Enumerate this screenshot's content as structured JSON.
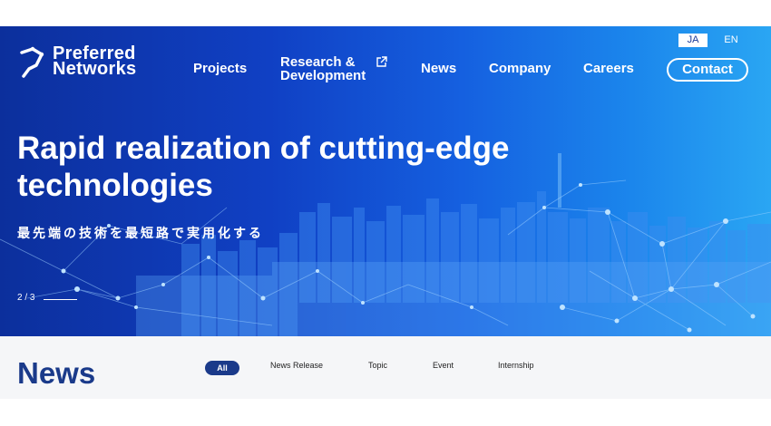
{
  "header": {
    "logo": {
      "line1": "Preferred",
      "line2": "Networks"
    },
    "nav": {
      "projects": "Projects",
      "research_line1": "Research &",
      "research_line2": "Development",
      "news": "News",
      "company": "Company",
      "careers": "Careers",
      "contact": "Contact"
    },
    "lang": {
      "ja": "JA",
      "en": "EN",
      "selected": "JA"
    }
  },
  "hero": {
    "headline_line1": "Rapid realization of cutting-edge",
    "headline_line2": "technologies",
    "subheadline": "最先端の技術を最短路で実用化する",
    "slide_counter": "2 / 3"
  },
  "news": {
    "title": "News",
    "filters": [
      "All",
      "News Release",
      "Topic",
      "Event",
      "Internship"
    ],
    "active_filter": "All"
  },
  "colors": {
    "hero_dark": "#0c2f9c",
    "hero_light": "#2aa6f3",
    "brand_navy": "#1a3a8a",
    "news_bg": "#f5f6f8"
  },
  "icons": {
    "external_link": "external-link-icon",
    "logo_mark": "pfn-logo-icon"
  }
}
